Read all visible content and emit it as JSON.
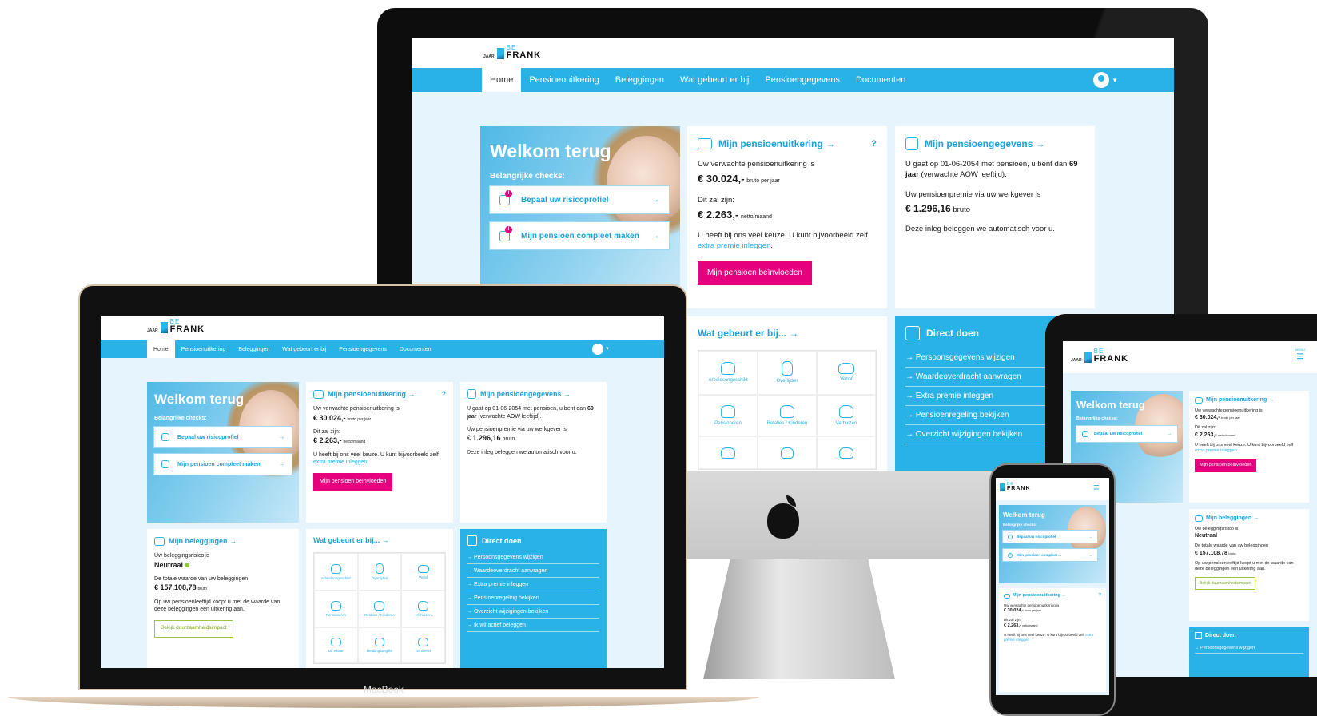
{
  "brand": {
    "jaar": "JAAR",
    "be": "BE",
    "frank": "FRANK"
  },
  "nav": {
    "home": "Home",
    "items": [
      "Pensioenuitkering",
      "Beleggingen",
      "Wat gebeurt er bij",
      "Pensioengegevens",
      "Documenten"
    ]
  },
  "hero": {
    "title": "Welkom terug",
    "subtitle": "Belangrijke checks:",
    "check1": "Bepaal uw risicoprofiel",
    "check2": "Mijn pensioen compleet maken",
    "check2_short": "Mijn pensioen compleet ...",
    "arrow": "→",
    "badge": "!"
  },
  "uitkering": {
    "title": "Mijn pensioenuitkering →",
    "help": "?",
    "line1": "Uw verwachte pensioenuitkering is",
    "amount1": "€ 30.024,-",
    "amount1_sub": "bruto per jaar",
    "line2": "Dit zal zijn:",
    "amount2": "€ 2.263,-",
    "amount2_sub": "netto/maand",
    "line3": "U heeft bij ons veel keuze. U kunt bijvoorbeeld zelf",
    "link": "extra premie inleggen",
    "dot": ".",
    "button": "Mijn pensioen beïnvloeden"
  },
  "gegevens": {
    "title": "Mijn pensioengegevens →",
    "line1": "U gaat op 01-06-2054 met pensioen, u bent dan",
    "age": "69",
    "line1b": "jaar",
    "line1c": "(verwachte AOW leeftijd).",
    "line2": "Uw pensioenpremie via uw werkgever is",
    "amount": "€ 1.296,16",
    "amount_sub": "bruto",
    "line3": "Deze inleg beleggen we automatisch voor u."
  },
  "beleggingen": {
    "title": "Mijn beleggingen →",
    "line1": "Uw beleggingsrisico is",
    "risk": "Neutraal",
    "line2": "De totale waarde van uw beleggingen",
    "amount": "€ 157.108,78",
    "amount_sub": "bruto",
    "line3": "Op uw pensioenleeftijd koopt u met de waarde van deze beleggingen een uitkering aan.",
    "button": "Bekijk duurzaamheidsimpact"
  },
  "watgebeurt": {
    "title": "Wat gebeurt er bij... →",
    "items": [
      "Arbeidsongeschikt",
      "Overlijden",
      "Verlof",
      "Pensioneren",
      "Relaties / Kinderen",
      "Verhuizen",
      "Uit elkaar",
      "Betalingsangifte",
      "Uit dienst"
    ]
  },
  "direct": {
    "title": "Direct doen",
    "items": [
      "→ Persoonsgegevens wijzigen",
      "→ Waardeoverdracht aanvragen",
      "→ Extra premie inleggen",
      "→ Pensioenregeling bekijken",
      "→ Overzicht wijzigingen bekijken",
      "→ Ik wil actief beleggen"
    ]
  },
  "devices": {
    "laptop_label": "MacBook",
    "menu": "MENU"
  }
}
